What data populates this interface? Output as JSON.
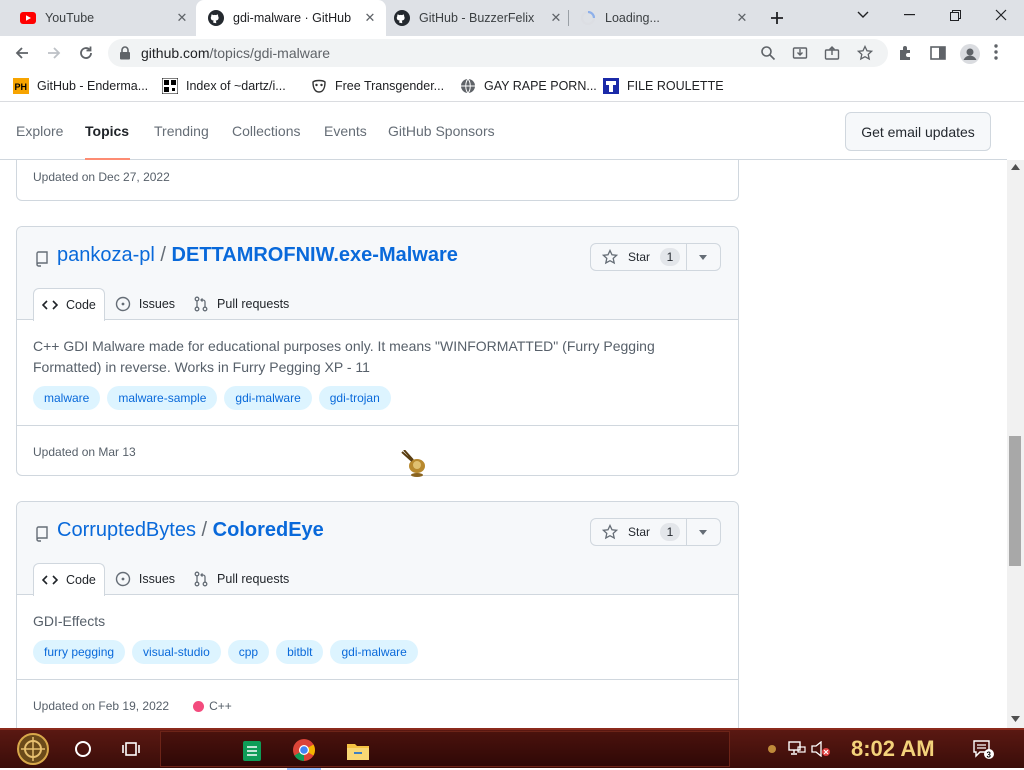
{
  "browser": {
    "tabs": [
      {
        "title": "YouTube",
        "favicon": "youtube-icon",
        "active": false
      },
      {
        "title": "gdi-malware · GitHub",
        "favicon": "github-icon",
        "active": true
      },
      {
        "title": "GitHub - BuzzerFelix",
        "favicon": "github-icon",
        "active": false
      },
      {
        "title": "Loading...",
        "favicon": "loading-icon",
        "active": false
      }
    ],
    "url_host": "github.com",
    "url_path": "/topics/gdi-malware",
    "bookmarks": [
      {
        "label": "GitHub - Enderma...",
        "icon": "ph-icon"
      },
      {
        "label": "Index of ~dartz/i...",
        "icon": "qr-icon"
      },
      {
        "label": "Free Transgender...",
        "icon": "mask-icon"
      },
      {
        "label": "GAY RAPE PORN...",
        "icon": "globe-icon"
      },
      {
        "label": "FILE ROULETTE",
        "icon": "roulette-icon"
      }
    ]
  },
  "github_nav": {
    "links": [
      "Explore",
      "Topics",
      "Trending",
      "Collections",
      "Events",
      "GitHub Sponsors"
    ],
    "active": "Topics",
    "email_button": "Get email updates"
  },
  "prev_card": {
    "updated": "Updated on Dec 27, 2022"
  },
  "repos": [
    {
      "owner": "pankoza-pl",
      "name": "DETTAMROFNIW.exe-Malware",
      "star_label": "Star",
      "star_count": "1",
      "tabs": [
        "Code",
        "Issues",
        "Pull requests"
      ],
      "description": "C++ GDI Malware made for educational purposes only. It means \"WINFORMATTED\" (Furry Pegging Formatted) in reverse. Works in Furry Pegging XP - 11",
      "topics": [
        "malware",
        "malware-sample",
        "gdi-malware",
        "gdi-trojan"
      ],
      "updated": "Updated on Mar 13",
      "language": ""
    },
    {
      "owner": "CorruptedBytes",
      "name": "ColoredEye",
      "star_label": "Star",
      "star_count": "1",
      "tabs": [
        "Code",
        "Issues",
        "Pull requests"
      ],
      "description": "GDI-Effects",
      "topics": [
        "furry pegging",
        "visual-studio",
        "cpp",
        "bitblt",
        "gdi-malware"
      ],
      "updated": "Updated on Feb 19, 2022",
      "language": "C++",
      "language_color": "#f34b7d"
    }
  ],
  "taskbar": {
    "time": "8:02 AM",
    "notification_count": "3"
  }
}
